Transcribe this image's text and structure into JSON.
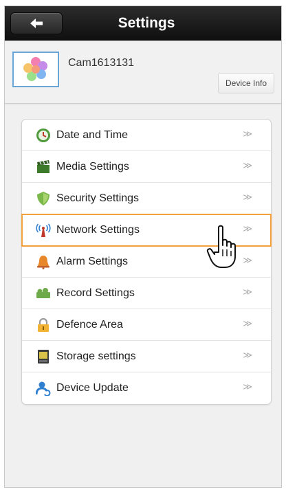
{
  "header": {
    "title": "Settings",
    "back_icon": "back-arrow-icon"
  },
  "device": {
    "name": "Cam1613131",
    "info_button": "Device Info",
    "thumb_icon": "camera-flower-icon"
  },
  "menu": {
    "items": [
      {
        "label": "Date and Time",
        "icon": "clock-icon",
        "chevron": "≫"
      },
      {
        "label": "Media Settings",
        "icon": "clapperboard-icon",
        "chevron": "≫"
      },
      {
        "label": "Security Settings",
        "icon": "shield-icon",
        "chevron": "≫"
      },
      {
        "label": "Network Settings",
        "icon": "antenna-icon",
        "chevron": "≫",
        "selected": true
      },
      {
        "label": "Alarm Settings",
        "icon": "bell-icon",
        "chevron": "≫"
      },
      {
        "label": "Record Settings",
        "icon": "record-icon",
        "chevron": "≫"
      },
      {
        "label": "Defence Area",
        "icon": "lock-icon",
        "chevron": "≫"
      },
      {
        "label": "Storage settings",
        "icon": "storage-icon",
        "chevron": "≫"
      },
      {
        "label": "Device Update",
        "icon": "user-update-icon",
        "chevron": "≫"
      }
    ]
  },
  "colors": {
    "accent_highlight": "#f2a03d",
    "titlebar": "#1a1a1a",
    "thumb_border": "#6aa5d8"
  },
  "cursor_icon": "hand-pointer-icon"
}
